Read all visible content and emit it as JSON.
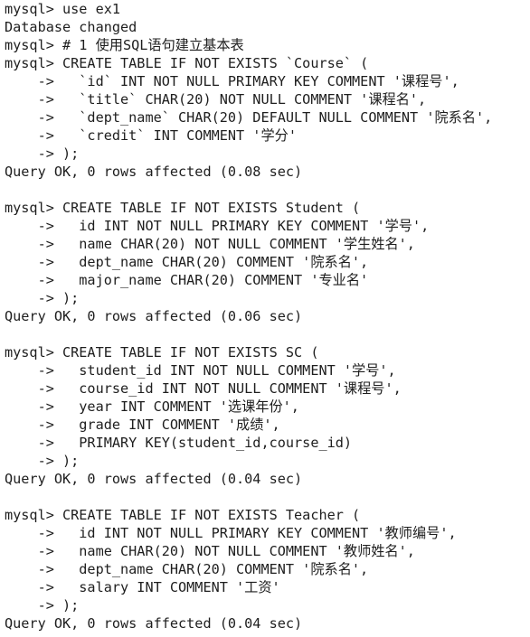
{
  "terminal": {
    "lines": [
      "mysql> use ex1",
      "Database changed",
      "mysql> # 1 使用SQL语句建立基本表",
      "mysql> CREATE TABLE IF NOT EXISTS `Course` (",
      "    ->   `id` INT NOT NULL PRIMARY KEY COMMENT '课程号',",
      "    ->   `title` CHAR(20) NOT NULL COMMENT '课程名',",
      "    ->   `dept_name` CHAR(20) DEFAULT NULL COMMENT '院系名',",
      "    ->   `credit` INT COMMENT '学分'",
      "    -> );",
      "Query OK, 0 rows affected (0.08 sec)",
      "",
      "mysql> CREATE TABLE IF NOT EXISTS Student (",
      "    ->   id INT NOT NULL PRIMARY KEY COMMENT '学号',",
      "    ->   name CHAR(20) NOT NULL COMMENT '学生姓名',",
      "    ->   dept_name CHAR(20) COMMENT '院系名',",
      "    ->   major_name CHAR(20) COMMENT '专业名'",
      "    -> );",
      "Query OK, 0 rows affected (0.06 sec)",
      "",
      "mysql> CREATE TABLE IF NOT EXISTS SC (",
      "    ->   student_id INT NOT NULL COMMENT '学号',",
      "    ->   course_id INT NOT NULL COMMENT '课程号',",
      "    ->   year INT COMMENT '选课年份',",
      "    ->   grade INT COMMENT '成绩',",
      "    ->   PRIMARY KEY(student_id,course_id)",
      "    -> );",
      "Query OK, 0 rows affected (0.04 sec)",
      "",
      "mysql> CREATE TABLE IF NOT EXISTS Teacher (",
      "    ->   id INT NOT NULL PRIMARY KEY COMMENT '教师编号',",
      "    ->   name CHAR(20) NOT NULL COMMENT '教师姓名',",
      "    ->   dept_name CHAR(20) COMMENT '院系名',",
      "    ->   salary INT COMMENT '工资'",
      "    -> );",
      "Query OK, 0 rows affected (0.04 sec)"
    ]
  }
}
